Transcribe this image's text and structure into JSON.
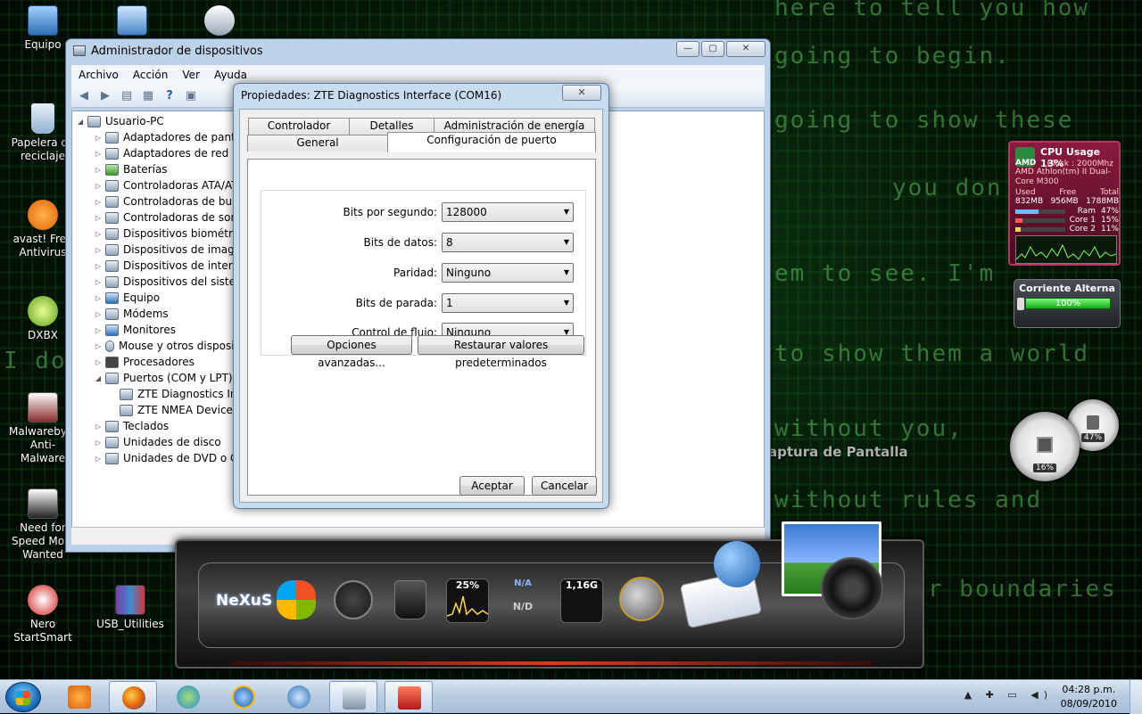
{
  "desktop": {
    "matrix_lines": [
      "here to tell you how",
      "going to begin.",
      "going to show these",
      "you don't",
      "em to see. I'm",
      "to show them a world",
      "without you,",
      "without rules and",
      "r boundaries",
      "I do"
    ],
    "watermark": "Captura de Pantalla",
    "icons": [
      {
        "name": "computer",
        "label": "Equipo"
      },
      {
        "name": "recycle-bin",
        "label": "Papelera de reciclaje"
      },
      {
        "name": "avast",
        "label": "avast! Free Antivirus"
      },
      {
        "name": "dxbx",
        "label": "DXBX"
      },
      {
        "name": "malwarebytes",
        "label": "Malwarebytes Anti-Malware"
      },
      {
        "name": "need-for-speed",
        "label": "Need for Speed Most Wanted"
      },
      {
        "name": "nero",
        "label": "Nero StartSmart"
      },
      {
        "name": "usb-utilities",
        "label": "USB_Utilities"
      }
    ]
  },
  "device_manager": {
    "title": "Administrador de dispositivos",
    "menu": [
      "Archivo",
      "Acción",
      "Ver",
      "Ayuda"
    ],
    "tree_root": "Usuario-PC",
    "tree_items": [
      "Adaptadores de pantalla",
      "Adaptadores de red",
      "Baterías",
      "Controladoras ATA/ATAPI",
      "Controladoras de bus serie",
      "Controladoras de sonido",
      "Dispositivos biométricos",
      "Dispositivos de imagen",
      "Dispositivos de interfaz",
      "Dispositivos del sistema",
      "Equipo",
      "Módems",
      "Monitores",
      "Mouse y otros dispositivos",
      "Procesadores",
      "Puertos (COM y LPT)",
      "ZTE Diagnostics Interface",
      "ZTE NMEA Device",
      "Teclados",
      "Unidades de disco",
      "Unidades de DVD o CD"
    ]
  },
  "properties": {
    "title": "Propiedades: ZTE Diagnostics Interface (COM16)",
    "close_label": "✕",
    "tabs_back": [
      "Controlador",
      "Detalles",
      "Administración de energía"
    ],
    "tabs_front": [
      "General",
      "Configuración de puerto"
    ],
    "fields": [
      {
        "label": "Bits por segundo:",
        "value": "128000"
      },
      {
        "label": "Bits de datos:",
        "value": "8"
      },
      {
        "label": "Paridad:",
        "value": "Ninguno"
      },
      {
        "label": "Bits de parada:",
        "value": "1"
      },
      {
        "label": "Control de flujo:",
        "value": "Ninguno"
      }
    ],
    "advanced_button": "Opciones avanzadas...",
    "restore_button": "Restaurar valores predeterminados",
    "ok_button": "Aceptar",
    "cancel_button": "Cancelar"
  },
  "cpu_gadget": {
    "title": "CPU Usage 13%",
    "brand": "AMD",
    "clock": "Clock : 2000Mhz",
    "cpu_name": "AMD Athlon(tm) II Dual-Core M300",
    "mem_headers": [
      "Used",
      "Free",
      "Total"
    ],
    "mem_values": [
      "832MB",
      "956MB",
      "1788MB"
    ],
    "bars": [
      {
        "label": "Ram",
        "value": "47%",
        "level": 47
      },
      {
        "label": "Core 1",
        "value": "15%",
        "level": 15
      },
      {
        "label": "Core 2",
        "value": "11%",
        "level": 11
      }
    ]
  },
  "power_gadget": {
    "title": "Corriente Alterna",
    "value": "100%",
    "level": 100
  },
  "gauges": {
    "cpu_value": "16%",
    "mem_value": "47%"
  },
  "dock": {
    "logo": "NeXuS",
    "cpu_meter": "25%",
    "net_meter": "N/A",
    "net_value": "N/D",
    "mem_meter": "1,16G"
  },
  "taskbar": {
    "time": "04:28 p.m.",
    "date": "08/09/2010",
    "tray_icons": "▲ ✚ ▭ ◀)"
  },
  "colors": {
    "window_frame": "#bcd2e8",
    "matrix_green": "#6edc6e",
    "cpu_gadget_bg": "#8a1a3e"
  }
}
